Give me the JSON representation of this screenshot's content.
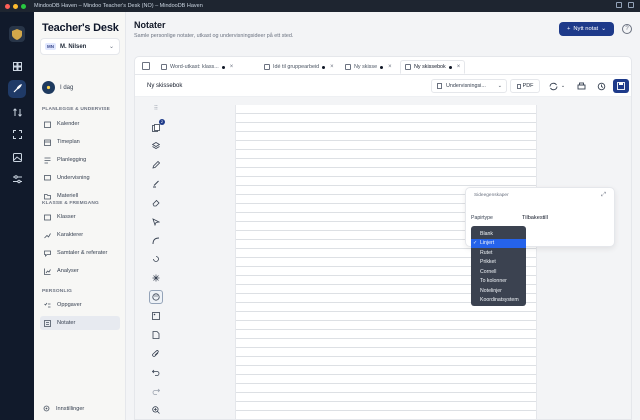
{
  "window": {
    "title": "MindooDB Haven – Mindoo Teacher's Desk (NO) – MindooDB Haven"
  },
  "brand": {
    "part1": "Teacher's",
    "part2": "Desk"
  },
  "user": {
    "initials": "MN",
    "name": "M. Nilsen"
  },
  "sidebar": {
    "today": "I dag",
    "sections": [
      {
        "heading": "PLANLEGGE & UNDERVISE",
        "items": [
          "Kalender",
          "Timeplan",
          "Planlegging",
          "Undervisning",
          "Materiell"
        ]
      },
      {
        "heading": "KLASSE & FREMGANG",
        "items": [
          "Klasser",
          "Karakterer",
          "Samtaler & referater",
          "Analyser"
        ]
      },
      {
        "heading": "PERSONLIG",
        "items": [
          "Oppgaver",
          "Notater"
        ]
      }
    ],
    "settings": "Innstillinger"
  },
  "header": {
    "title": "Notater",
    "subtitle": "Samle personlige notater, utkast og undervisningsideer på ett sted.",
    "new_note": "Nytt notat"
  },
  "tabs": [
    {
      "label": "Word-utkast: klass...",
      "dirty": true
    },
    {
      "label": "Idé til gruppearbeid",
      "dirty": true
    },
    {
      "label": "Ny skisse",
      "dirty": true
    },
    {
      "label": "Ny skissebok",
      "dirty": true,
      "active": true
    }
  ],
  "note": {
    "title": "Ny skissebok",
    "view_select": "Undervisningsi...",
    "pdf": "PDF"
  },
  "tool_badge": "2",
  "props": {
    "heading": "Sideegenskaper",
    "paper_label": "Papirtype",
    "reset": "Tilbakestill"
  },
  "paper_options": [
    "Blank",
    "Linjert",
    "Rutet",
    "Prikket",
    "Cornell",
    "To kolonner",
    "Notelinjer",
    "Koordinatsystem"
  ],
  "paper_selected": "Linjert",
  "colors": {
    "accent": "#1e3a8a",
    "rail": "#111a2b",
    "dropdown": "#3b4250",
    "highlight": "#2563eb"
  }
}
